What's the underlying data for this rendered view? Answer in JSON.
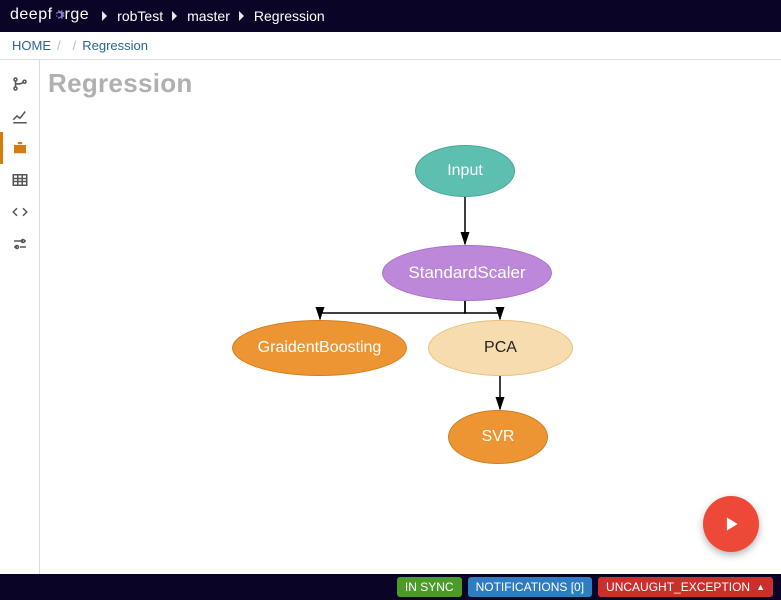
{
  "header": {
    "logo_pre": "deep",
    "logo_mid": "f",
    "logo_post": "rge",
    "crumbs": [
      "robTest",
      "master",
      "Regression"
    ]
  },
  "breadcrumb": {
    "home": "HOME",
    "current": "Regression"
  },
  "sidebar": {
    "items": [
      {
        "name": "branch-icon",
        "active": false
      },
      {
        "name": "chart-line-icon",
        "active": false
      },
      {
        "name": "briefcase-icon",
        "active": true
      },
      {
        "name": "table-icon",
        "active": false
      },
      {
        "name": "code-icon",
        "active": false
      },
      {
        "name": "sliders-icon",
        "active": false
      }
    ]
  },
  "canvas": {
    "title": "Regression",
    "nodes": {
      "input": "Input",
      "scaler": "StandardScaler",
      "gboost": "GraidentBoosting",
      "pca": "PCA",
      "svr": "SVR"
    }
  },
  "fab": {
    "label": "run"
  },
  "status": {
    "sync": "IN SYNC",
    "notifications": "NOTIFICATIONS [0]",
    "error": "UNCAUGHT_EXCEPTION"
  }
}
